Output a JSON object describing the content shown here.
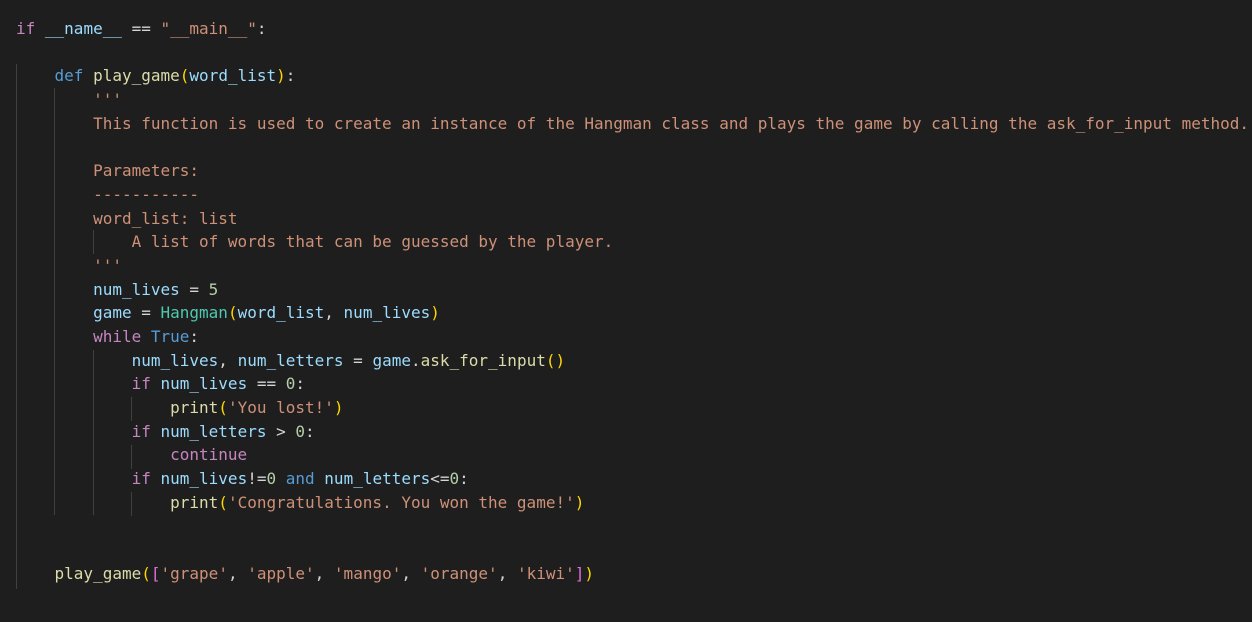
{
  "editor": {
    "lines": [
      [
        [
          "kw",
          "if"
        ],
        [
          "op",
          " "
        ],
        [
          "var",
          "__name__"
        ],
        [
          "op",
          " == "
        ],
        [
          "str",
          "\"__main__\""
        ],
        [
          "op",
          ":"
        ]
      ],
      [],
      [
        [
          "op",
          "    "
        ],
        [
          "kw2",
          "def"
        ],
        [
          "op",
          " "
        ],
        [
          "fn",
          "play_game"
        ],
        [
          "b1",
          "("
        ],
        [
          "var",
          "word_list"
        ],
        [
          "b1",
          ")"
        ],
        [
          "op",
          ":"
        ]
      ],
      [
        [
          "op",
          "        "
        ],
        [
          "str",
          "'''"
        ]
      ],
      [
        [
          "op",
          "        "
        ],
        [
          "str",
          "This function is used to create an instance of the Hangman class and plays the game by calling the ask_for_input method."
        ]
      ],
      [],
      [
        [
          "op",
          "        "
        ],
        [
          "str",
          "Parameters:"
        ]
      ],
      [
        [
          "op",
          "        "
        ],
        [
          "str",
          "-----------"
        ]
      ],
      [
        [
          "op",
          "        "
        ],
        [
          "str",
          "word_list: list"
        ]
      ],
      [
        [
          "op",
          "            "
        ],
        [
          "str",
          "A list of words that can be guessed by the player."
        ]
      ],
      [
        [
          "op",
          "        "
        ],
        [
          "str",
          "'''"
        ]
      ],
      [
        [
          "op",
          "        "
        ],
        [
          "var",
          "num_lives"
        ],
        [
          "op",
          " = "
        ],
        [
          "num",
          "5"
        ]
      ],
      [
        [
          "op",
          "        "
        ],
        [
          "var",
          "game"
        ],
        [
          "op",
          " = "
        ],
        [
          "cls",
          "Hangman"
        ],
        [
          "b1",
          "("
        ],
        [
          "var",
          "word_list"
        ],
        [
          "op",
          ", "
        ],
        [
          "var",
          "num_lives"
        ],
        [
          "b1",
          ")"
        ]
      ],
      [
        [
          "op",
          "        "
        ],
        [
          "kw",
          "while"
        ],
        [
          "op",
          " "
        ],
        [
          "kw2",
          "True"
        ],
        [
          "op",
          ":"
        ]
      ],
      [
        [
          "op",
          "            "
        ],
        [
          "var",
          "num_lives"
        ],
        [
          "op",
          ", "
        ],
        [
          "var",
          "num_letters"
        ],
        [
          "op",
          " = "
        ],
        [
          "var",
          "game"
        ],
        [
          "op",
          "."
        ],
        [
          "fn",
          "ask_for_input"
        ],
        [
          "b1",
          "()"
        ]
      ],
      [
        [
          "op",
          "            "
        ],
        [
          "kw",
          "if"
        ],
        [
          "op",
          " "
        ],
        [
          "var",
          "num_lives"
        ],
        [
          "op",
          " == "
        ],
        [
          "num",
          "0"
        ],
        [
          "op",
          ":"
        ]
      ],
      [
        [
          "op",
          "                "
        ],
        [
          "fn",
          "print"
        ],
        [
          "b1",
          "("
        ],
        [
          "str",
          "'You lost!'"
        ],
        [
          "b1",
          ")"
        ]
      ],
      [
        [
          "op",
          "            "
        ],
        [
          "kw",
          "if"
        ],
        [
          "op",
          " "
        ],
        [
          "var",
          "num_letters"
        ],
        [
          "op",
          " > "
        ],
        [
          "num",
          "0"
        ],
        [
          "op",
          ":"
        ]
      ],
      [
        [
          "op",
          "                "
        ],
        [
          "kw",
          "continue"
        ]
      ],
      [
        [
          "op",
          "            "
        ],
        [
          "kw",
          "if"
        ],
        [
          "op",
          " "
        ],
        [
          "var",
          "num_lives"
        ],
        [
          "op",
          "!="
        ],
        [
          "num",
          "0"
        ],
        [
          "op",
          " "
        ],
        [
          "kw2",
          "and"
        ],
        [
          "op",
          " "
        ],
        [
          "var",
          "num_letters"
        ],
        [
          "op",
          "<="
        ],
        [
          "num",
          "0"
        ],
        [
          "op",
          ":"
        ]
      ],
      [
        [
          "op",
          "                "
        ],
        [
          "fn",
          "print"
        ],
        [
          "b1",
          "("
        ],
        [
          "str",
          "'Congratulations. You won the game!'"
        ],
        [
          "b1",
          ")"
        ]
      ],
      [],
      [],
      [
        [
          "op",
          "    "
        ],
        [
          "fn",
          "play_game"
        ],
        [
          "b1",
          "("
        ],
        [
          "b2",
          "["
        ],
        [
          "str",
          "'grape'"
        ],
        [
          "op",
          ", "
        ],
        [
          "str",
          "'apple'"
        ],
        [
          "op",
          ", "
        ],
        [
          "str",
          "'mango'"
        ],
        [
          "op",
          ", "
        ],
        [
          "str",
          "'orange'"
        ],
        [
          "op",
          ", "
        ],
        [
          "str",
          "'kiwi'"
        ],
        [
          "b2",
          "]"
        ],
        [
          "b1",
          ")"
        ]
      ]
    ]
  }
}
